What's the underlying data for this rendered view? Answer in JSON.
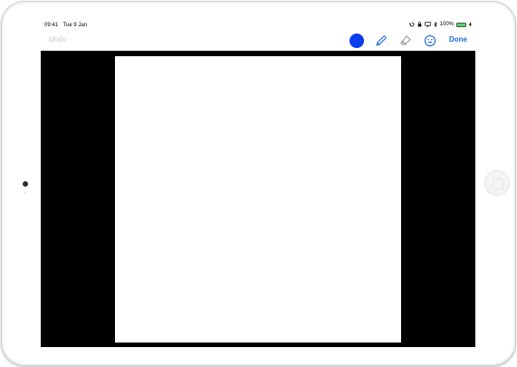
{
  "status_bar": {
    "time": "09:41",
    "date": "Tue 9 Jan",
    "battery": "100%",
    "battery_level": 1.0
  },
  "toolbar": {
    "undo_label": "Undo",
    "done_label": "Done",
    "selected_color": "#0a3cf0",
    "tools": [
      "color-swatch-icon",
      "pencil-icon",
      "eraser-icon",
      "emoji-icon"
    ]
  },
  "colors": {
    "accent": "#1a6be0",
    "disabled": "#c7c7cc",
    "canvas_background": "#000000",
    "canvas": "#ffffff"
  }
}
